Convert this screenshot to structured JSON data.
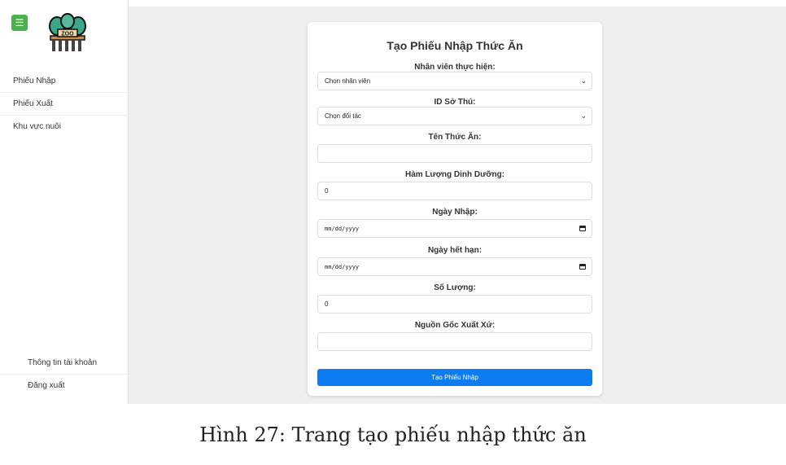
{
  "sidebar": {
    "menu_icon": "hamburger-icon",
    "logo_text": "ZOO",
    "nav_items": [
      {
        "label": "Phiếu Nhập"
      },
      {
        "label": "Phiếu Xuất"
      },
      {
        "label": "Khu vực nuôi"
      }
    ],
    "bottom_items": [
      {
        "label": "Thông tin tài khoản"
      },
      {
        "label": "Đăng xuất"
      }
    ]
  },
  "form": {
    "title": "Tạo Phiếu Nhập Thức Ăn",
    "staff": {
      "label": "Nhân viên thực hiện:",
      "value": "Chọn nhân viên"
    },
    "zoo": {
      "label": "ID Sở Thú:",
      "value": "Chọn đối tác"
    },
    "food_name": {
      "label": "Tên Thức Ăn:",
      "value": ""
    },
    "nutrition": {
      "label": "Hàm Lượng Dinh Dưỡng:",
      "value": "0"
    },
    "import_date": {
      "label": "Ngày Nhập:",
      "placeholder": "mm/dd/yyyy"
    },
    "expiry_date": {
      "label": "Ngày hết hạn:",
      "placeholder": "mm/dd/yyyy"
    },
    "quantity": {
      "label": "Số Lượng:",
      "value": "0"
    },
    "origin": {
      "label": "Nguồn Gốc Xuất Xứ:",
      "value": ""
    },
    "submit_label": "Tạo Phiếu Nhập"
  },
  "caption": "Hình 27: Trang tạo phiếu nhập thức ăn",
  "colors": {
    "accent": "#0d7cf2",
    "menu_button": "#4caf50",
    "background": "#efefef"
  }
}
